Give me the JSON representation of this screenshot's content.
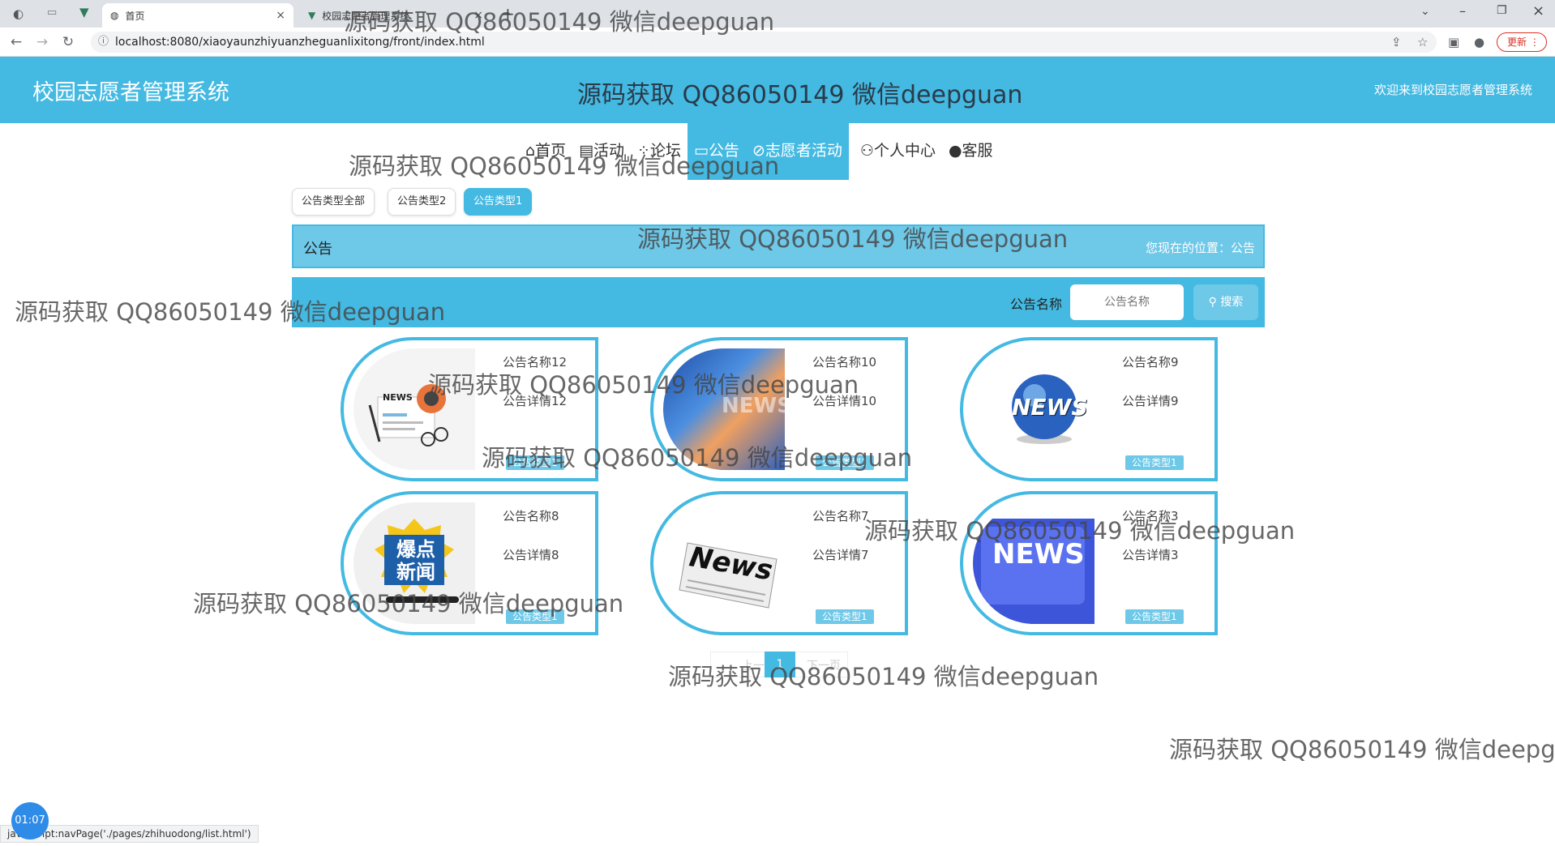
{
  "browser": {
    "tabs": [
      {
        "title": "首页",
        "active": true
      },
      {
        "title": "校园志愿者管理系统",
        "active": false
      }
    ],
    "new_tab": "+",
    "url": "localhost:8080/xiaoyaunzhiyuanzheguanlixitong/front/index.html",
    "update_label": "更新",
    "status_url": "javascript:navPage('./pages/zhihuodong/list.html')",
    "timer": "01:07"
  },
  "header": {
    "site_title": "校园志愿者管理系统",
    "center_text": "源码获取 QQ86050149 微信deepguan",
    "welcome": "欢迎来到校园志愿者管理系统"
  },
  "nav": [
    {
      "icon": "home-icon",
      "glyph": "⌂",
      "label": "首页",
      "active": false
    },
    {
      "icon": "activity-icon",
      "glyph": "▤",
      "label": "活动",
      "active": false
    },
    {
      "icon": "forum-icon",
      "glyph": "⁘",
      "label": "论坛",
      "active": false
    },
    {
      "icon": "notice-icon",
      "glyph": "▭",
      "label": "公告",
      "active": true
    },
    {
      "icon": "volunteer-icon",
      "glyph": "⊘",
      "label": "志愿者活动",
      "active": true
    },
    {
      "icon": "user-icon",
      "glyph": "⚇",
      "label": "个人中心",
      "active": false
    },
    {
      "icon": "service-icon",
      "glyph": "●",
      "label": "客服",
      "active": false
    }
  ],
  "filters": [
    {
      "label": "公告类型全部",
      "active": false
    },
    {
      "label": "公告类型2",
      "active": false
    },
    {
      "label": "公告类型1",
      "active": true
    }
  ],
  "breadcrumb": {
    "title": "公告",
    "location": "您现在的位置：公告"
  },
  "search": {
    "label": "公告名称",
    "placeholder": "公告名称",
    "button": "搜索"
  },
  "cards": [
    {
      "name": "公告名称12",
      "detail": "公告详情12",
      "badge": "公告类型1",
      "image": "news-paper-icon"
    },
    {
      "name": "公告名称10",
      "detail": "公告详情10",
      "badge": "公告类型1",
      "image": "news-globe-photo"
    },
    {
      "name": "公告名称9",
      "detail": "公告详情9",
      "badge": "公告类型1",
      "image": "news-globe-icon"
    },
    {
      "name": "公告名称8",
      "detail": "公告详情8",
      "badge": "公告类型1",
      "image": "breaking-news-icon"
    },
    {
      "name": "公告名称7",
      "detail": "公告详情7",
      "badge": "公告类型1",
      "image": "newspaper-icon"
    },
    {
      "name": "公告名称3",
      "detail": "公告详情3",
      "badge": "公告类型1",
      "image": "news-key-icon"
    }
  ],
  "pager": {
    "prev": "上一页",
    "current": "1",
    "next": "下一页"
  },
  "watermark": "源码获取 QQ86050149 微信deepguan",
  "image_text": {
    "news": "NEWS",
    "news_italic": "News",
    "breaking": "爆点新闻"
  },
  "colors": {
    "primary": "#44b9e2",
    "light": "#6ec8e8"
  }
}
